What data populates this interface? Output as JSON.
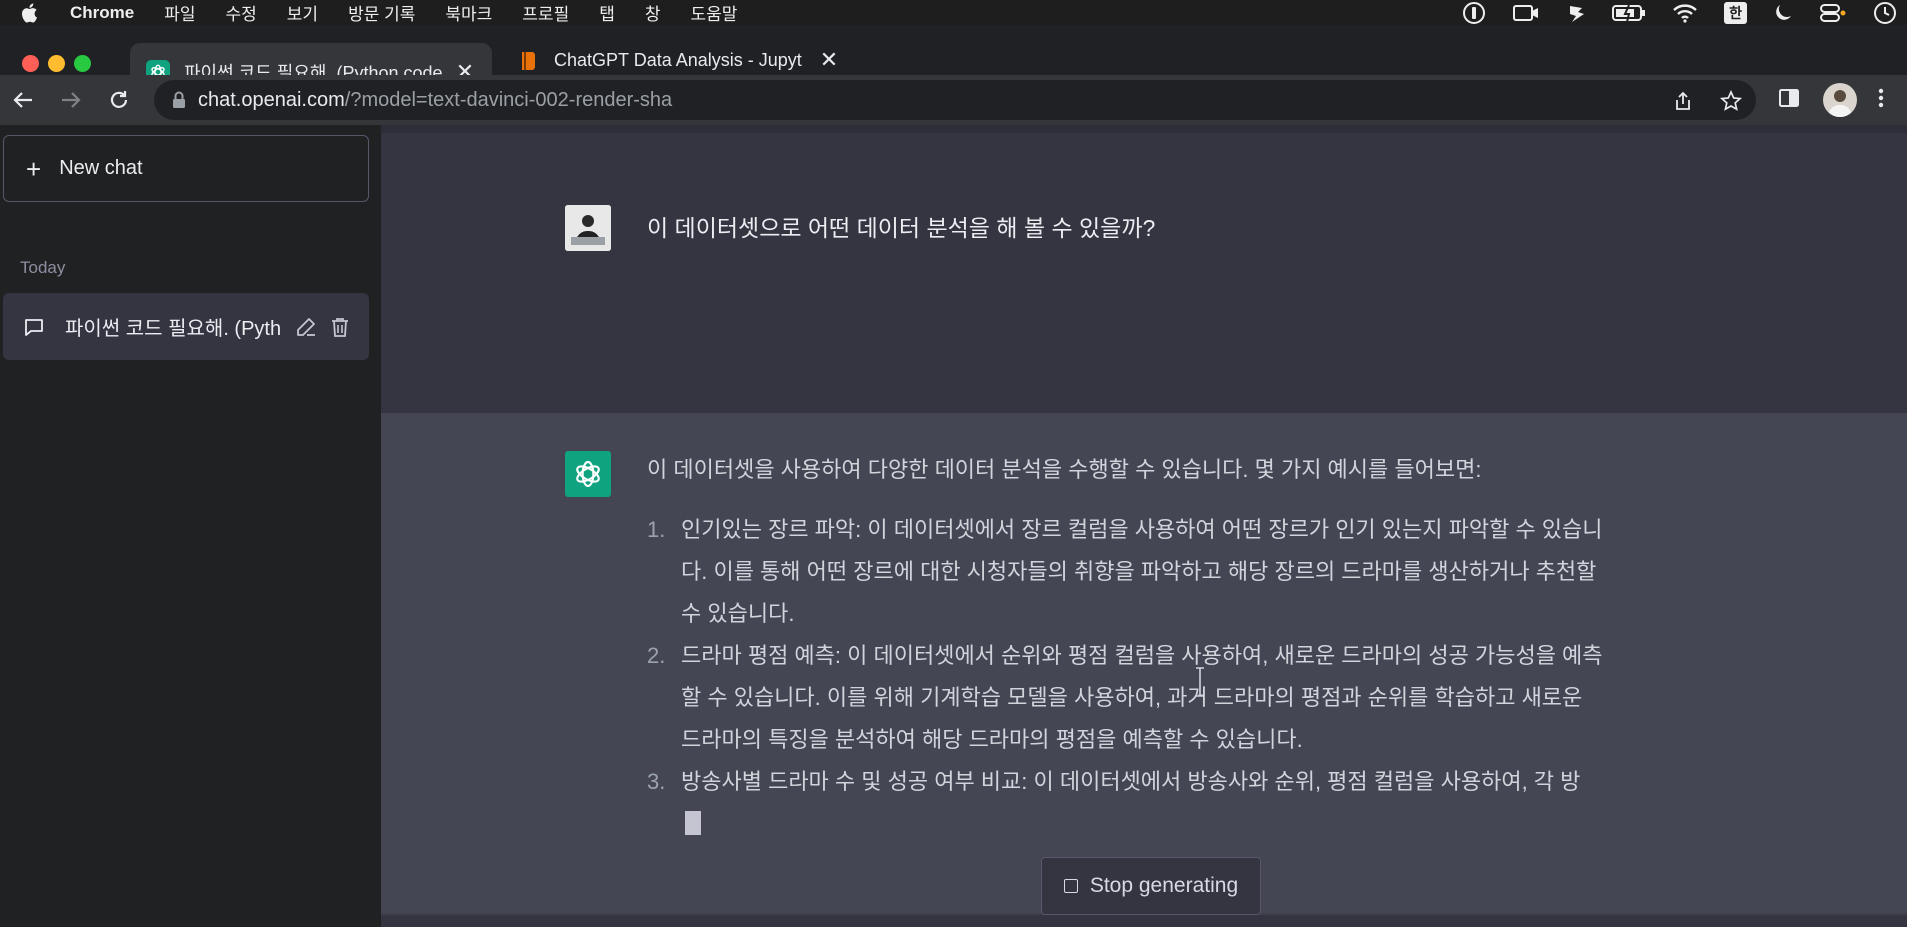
{
  "menubar": {
    "app_name": "Chrome",
    "items": [
      "파일",
      "수정",
      "보기",
      "방문 기록",
      "북마크",
      "프로필",
      "탭",
      "창",
      "도움말"
    ],
    "input_source": "한"
  },
  "tabs": [
    {
      "title": "파이썬 코드 필요해. (Python code",
      "favicon": "openai-icon"
    },
    {
      "title": "ChatGPT Data Analysis - Jupyt",
      "favicon": "jupyter-icon"
    }
  ],
  "address_bar": {
    "host": "chat.openai.com",
    "path": "/?model=text-davinci-002-render-sha"
  },
  "sidebar": {
    "new_chat_label": "New chat",
    "section_today": "Today",
    "history": [
      {
        "label": "파이썬 코드 필요해. (Pyth"
      }
    ]
  },
  "conversation": {
    "user_message": "이 데이터셋으로 어떤 데이터 분석을 해 볼 수 있을까?",
    "assistant_intro": "이 데이터셋을 사용하여 다양한 데이터 분석을 수행할 수 있습니다. 몇 가지 예시를 들어보면:",
    "assistant_items": [
      {
        "num": "1.",
        "text": "인기있는 장르 파악: 이 데이터셋에서 장르 컬럼을 사용하여 어떤 장르가 인기 있는지 파악할 수 있습니다. 이를 통해 어떤 장르에 대한 시청자들의 취향을 파악하고 해당 장르의 드라마를 생산하거나 추천할 수 있습니다."
      },
      {
        "num": "2.",
        "text": "드라마 평점 예측: 이 데이터셋에서 순위와 평점 컬럼을 사용하여, 새로운 드라마의 성공 가능성을 예측할 수 있습니다. 이를 위해 기계학습 모델을 사용하여, 과거 드라마의 평점과 순위를 학습하고 새로운 드라마의 특징을 분석하여 해당 드라마의 평점을 예측할 수 있습니다."
      },
      {
        "num": "3.",
        "text": "방송사별 드라마 수 및 성공 여부 비교: 이 데이터셋에서 방송사와 순위, 평점 컬럼을 사용하여, 각 방"
      }
    ]
  },
  "stop_button_label": "Stop generating",
  "colors": {
    "sidebar_bg": "#202123",
    "main_bg": "#343541",
    "assistant_bg": "#444654",
    "accent": "#10a37f"
  }
}
